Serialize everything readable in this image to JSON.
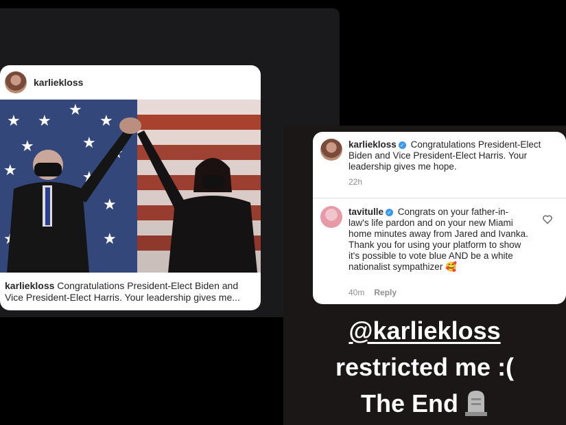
{
  "post": {
    "username": "karliekloss",
    "caption_user": "karliekloss",
    "caption_text": " Congratulations President-Elect Biden and Vice President-Elect Harris. Your leadership gives me..."
  },
  "comments": [
    {
      "username": "karliekloss",
      "text": " Congratulations President-Elect Biden and Vice President-Elect Harris. Your leadership gives me hope.",
      "time": "22h"
    },
    {
      "username": "tavitulle",
      "text": " Congrats on your father-in-law's life pardon and on your new Miami home minutes away from Jared and Ivanka. Thank you for using your platform to show it's possible to vote blue AND be a white nationalist sympathizer 🥰",
      "time": "40m",
      "reply_label": "Reply"
    }
  ],
  "story": {
    "mention": "@karliekloss",
    "line2": "restricted me :(",
    "line3": "The End"
  },
  "icons": [
    "verified-badge-icon",
    "heart-icon",
    "tombstone-icon"
  ],
  "colors": {
    "background": "#000000",
    "verified": "#3897f0",
    "meta_gray": "#8e8e8e"
  }
}
